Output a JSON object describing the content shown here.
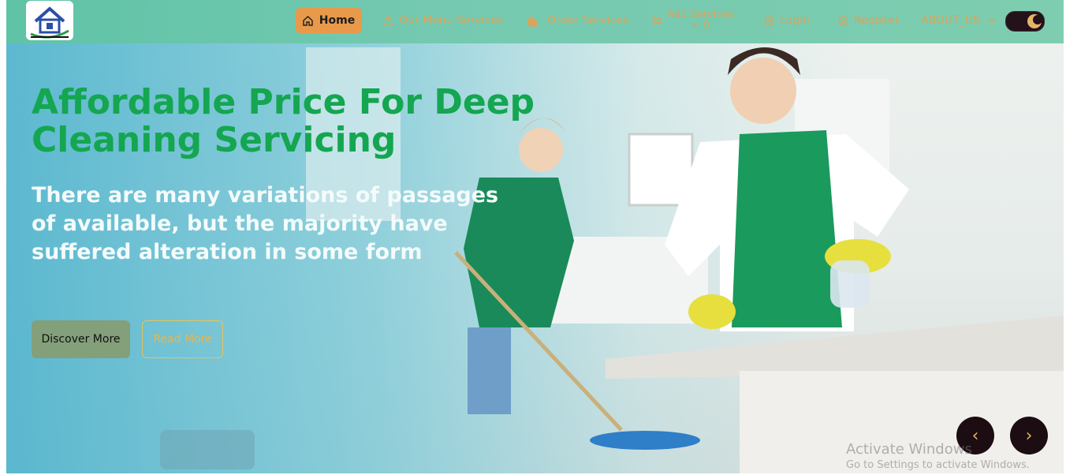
{
  "navbar": {
    "items": [
      {
        "label": "Home",
        "icon": "home-icon",
        "active": true
      },
      {
        "label": "Our Menu Services",
        "icon": "upload-icon"
      },
      {
        "label": "Order Services",
        "icon": "fire-icon"
      },
      {
        "label": "Add Services",
        "sub": "+ 0",
        "icon": "cart-icon"
      },
      {
        "label": "Login",
        "icon": "login-icon"
      },
      {
        "label": "Register",
        "icon": "register-icon"
      },
      {
        "label": "ABOUT_US",
        "icon": "chevron-down-icon"
      }
    ],
    "theme_toggle": "dark-mode-icon"
  },
  "hero": {
    "title": "Affordable Price For Deep Cleaning Servicing",
    "subtitle": "There are many variations of passages of available, but the majority have suffered alteration in some form",
    "primary_button": "Discover More",
    "secondary_button": "Read More"
  },
  "carousel": {
    "prev": "‹",
    "next": "›"
  },
  "watermark": {
    "line1": "Activate Windows",
    "line2": "Go to Settings to activate Windows."
  },
  "colors": {
    "title_green": "#14a650",
    "nav_bg": "#6fc8ae",
    "accent_orange": "#e89a4a"
  }
}
